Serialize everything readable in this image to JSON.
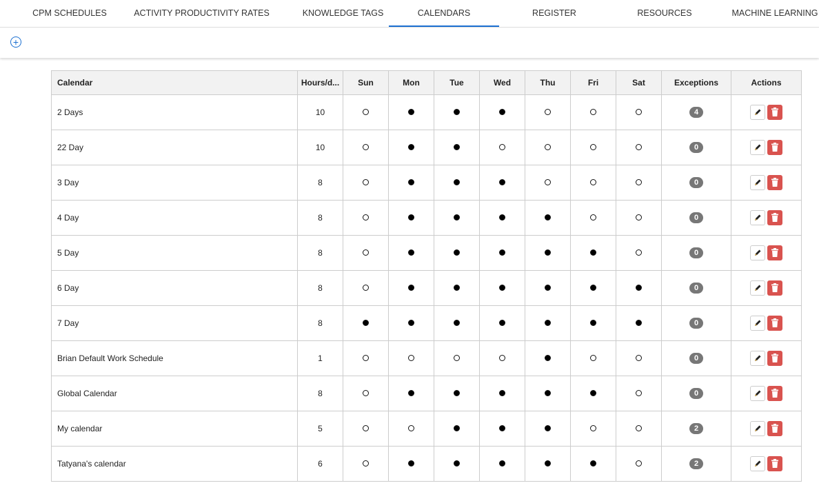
{
  "tabs": [
    {
      "label": "CPM SCHEDULES"
    },
    {
      "label": "ACTIVITY PRODUCTIVITY RATES"
    },
    {
      "label": "KNOWLEDGE TAGS"
    },
    {
      "label": "CALENDARS",
      "active": true
    },
    {
      "label": "REGISTER"
    },
    {
      "label": "RESOURCES"
    },
    {
      "label": "MACHINE LEARNING"
    }
  ],
  "toolbar": {
    "add_icon": "plus-circle-icon",
    "add_glyph": "+"
  },
  "table": {
    "headers": [
      "Calendar",
      "Hours/d...",
      "Sun",
      "Mon",
      "Tue",
      "Wed",
      "Thu",
      "Fri",
      "Sat",
      "Exceptions",
      "Actions"
    ],
    "rows": [
      {
        "name": "2 Days",
        "hours": "10",
        "days": [
          0,
          1,
          1,
          1,
          0,
          0,
          0
        ],
        "exceptions": "4"
      },
      {
        "name": "22 Day",
        "hours": "10",
        "days": [
          0,
          1,
          1,
          0,
          0,
          0,
          0
        ],
        "exceptions": "0"
      },
      {
        "name": "3 Day",
        "hours": "8",
        "days": [
          0,
          1,
          1,
          1,
          0,
          0,
          0
        ],
        "exceptions": "0"
      },
      {
        "name": "4 Day",
        "hours": "8",
        "days": [
          0,
          1,
          1,
          1,
          1,
          0,
          0
        ],
        "exceptions": "0"
      },
      {
        "name": "5 Day",
        "hours": "8",
        "days": [
          0,
          1,
          1,
          1,
          1,
          1,
          0
        ],
        "exceptions": "0"
      },
      {
        "name": "6 Day",
        "hours": "8",
        "days": [
          0,
          1,
          1,
          1,
          1,
          1,
          1
        ],
        "exceptions": "0"
      },
      {
        "name": "7 Day",
        "hours": "8",
        "days": [
          1,
          1,
          1,
          1,
          1,
          1,
          1
        ],
        "exceptions": "0"
      },
      {
        "name": "Brian Default Work Schedule",
        "hours": "1",
        "days": [
          0,
          0,
          0,
          0,
          1,
          0,
          0
        ],
        "exceptions": "0"
      },
      {
        "name": "Global Calendar",
        "hours": "8",
        "days": [
          0,
          1,
          1,
          1,
          1,
          1,
          0
        ],
        "exceptions": "0"
      },
      {
        "name": "My calendar",
        "hours": "5",
        "days": [
          0,
          0,
          1,
          1,
          1,
          0,
          0
        ],
        "exceptions": "2"
      },
      {
        "name": "Tatyana's calendar",
        "hours": "6",
        "days": [
          0,
          1,
          1,
          1,
          1,
          1,
          0
        ],
        "exceptions": "2"
      }
    ]
  },
  "icons": {
    "edit": "pencil-icon",
    "delete": "trash-icon"
  },
  "colors": {
    "accent": "#1a6fd1",
    "delete": "#d9534f",
    "badge": "#777777"
  }
}
